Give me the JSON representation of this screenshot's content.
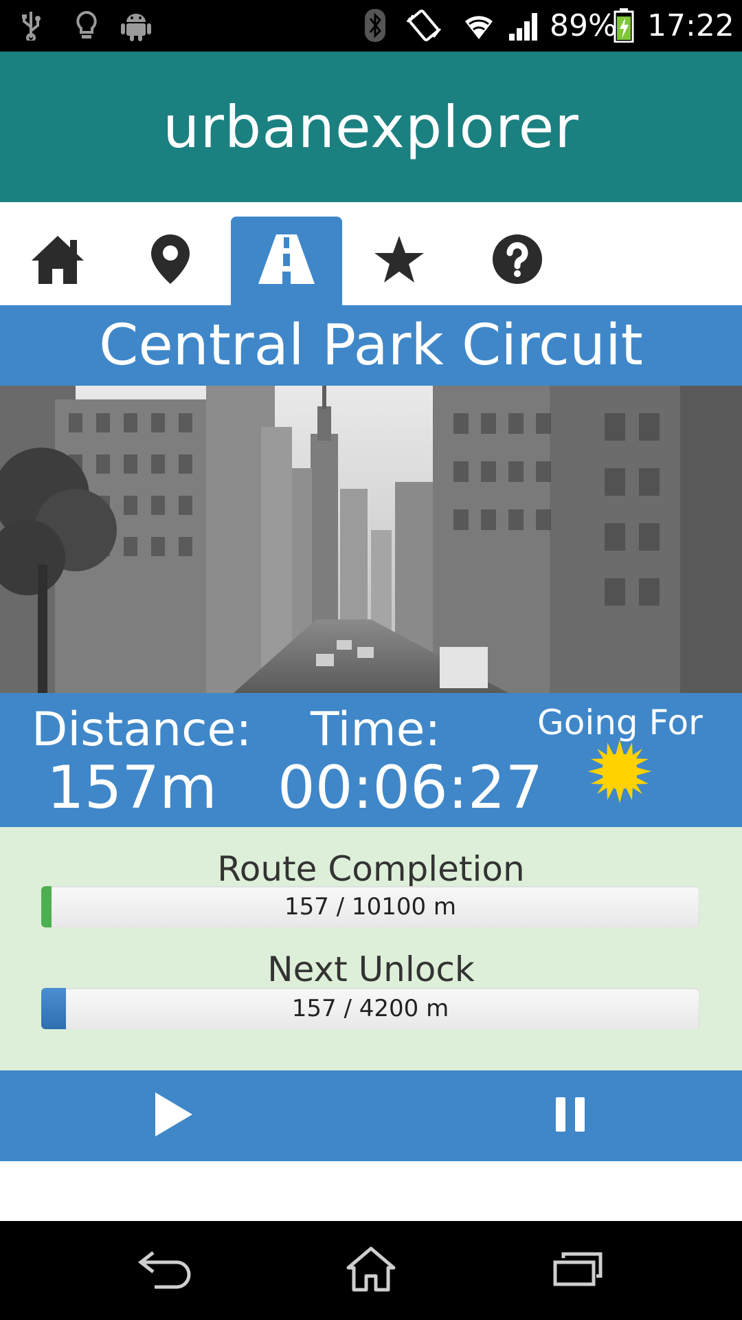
{
  "status_bar": {
    "battery": "89%",
    "time": "17:22",
    "icons": [
      "usb-icon",
      "lightbulb-icon",
      "android-icon",
      "bluetooth-icon",
      "vibrate-icon",
      "wifi-icon",
      "signal-icon",
      "battery-charging-icon"
    ]
  },
  "header": {
    "title": "urbanexplorer"
  },
  "tabs": [
    {
      "icon": "home-icon",
      "active": false
    },
    {
      "icon": "location-pin-icon",
      "active": false
    },
    {
      "icon": "road-icon",
      "active": true
    },
    {
      "icon": "star-icon",
      "active": false
    },
    {
      "icon": "help-icon",
      "active": false
    }
  ],
  "route": {
    "title": "Central Park Circuit"
  },
  "stats": {
    "distance_label": "Distance:",
    "distance_value": "157m",
    "time_label": "Time:",
    "time_value": "00:06:27",
    "going_for_label": "Going For",
    "going_for_icon": "sun-icon"
  },
  "progress": {
    "completion_title": "Route Completion",
    "completion_text": "157 / 10100 m",
    "completion_fraction": 0.0155,
    "unlock_title": "Next Unlock",
    "unlock_text": "157 / 4200 m",
    "unlock_fraction": 0.0374
  },
  "controls": {
    "play_icon": "play-icon",
    "pause_icon": "pause-icon"
  },
  "nav": {
    "icons": [
      "back-icon",
      "home-nav-icon",
      "recents-icon"
    ]
  },
  "colors": {
    "header": "#1b8080",
    "accent": "#3f87c9",
    "progress_bg": "#ddefd8",
    "completion_fill": "#4caf50",
    "unlock_fill": "#2e6fb0",
    "sun": "#ffd200"
  }
}
